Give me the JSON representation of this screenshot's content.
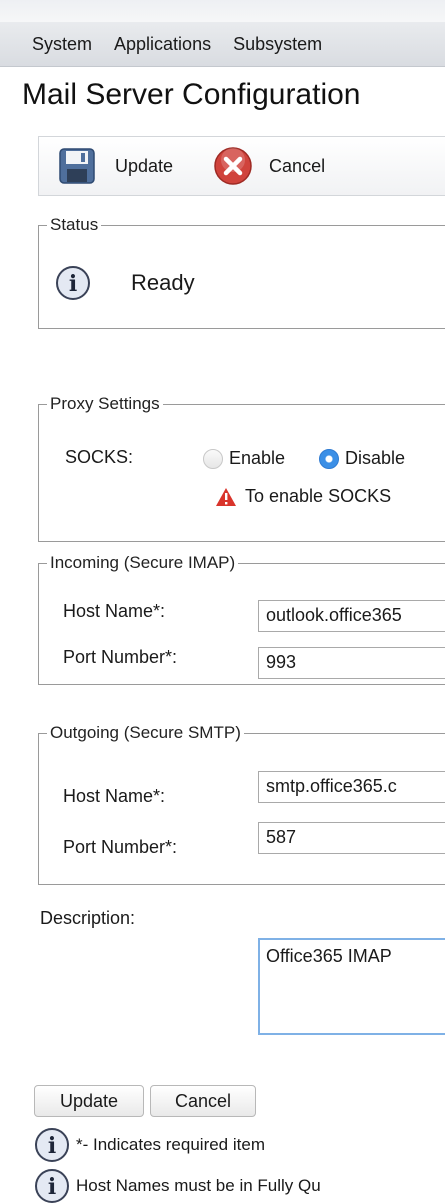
{
  "menu": {
    "items": [
      "System",
      "Applications",
      "Subsystem"
    ]
  },
  "page": {
    "title": "Mail Server Configuration"
  },
  "toolbar": {
    "update_label": "Update",
    "cancel_label": "Cancel"
  },
  "status": {
    "legend": "Status",
    "text": "Ready"
  },
  "proxy": {
    "legend": "Proxy Settings",
    "socks_label": "SOCKS:",
    "enable_label": "Enable",
    "disable_label": "Disable",
    "selected": "Disable",
    "warning": "To enable SOCKS"
  },
  "incoming": {
    "legend": "Incoming (Secure IMAP)",
    "host_label": "Host Name*:",
    "host_value": "outlook.office365",
    "port_label": "Port Number*:",
    "port_value": "993"
  },
  "outgoing": {
    "legend": "Outgoing (Secure SMTP)",
    "host_label": "Host Name*:",
    "host_value": "smtp.office365.c",
    "port_label": "Port Number*:",
    "port_value": "587"
  },
  "description": {
    "label": "Description:",
    "value": "Office365 IMAP"
  },
  "footer": {
    "update_label": "Update",
    "cancel_label": "Cancel",
    "notes": [
      "*- Indicates required item",
      "Host Names must be in Fully Qu"
    ]
  },
  "colors": {
    "accent": "#3b8fe6",
    "warning": "#d9342b",
    "cancel_icon": "#d0433c",
    "focus_border": "#7fb1e6"
  },
  "icons": {
    "update": "floppy-disk-icon",
    "cancel": "cancel-x-icon",
    "info": "info-icon",
    "warning": "warning-triangle-icon"
  }
}
